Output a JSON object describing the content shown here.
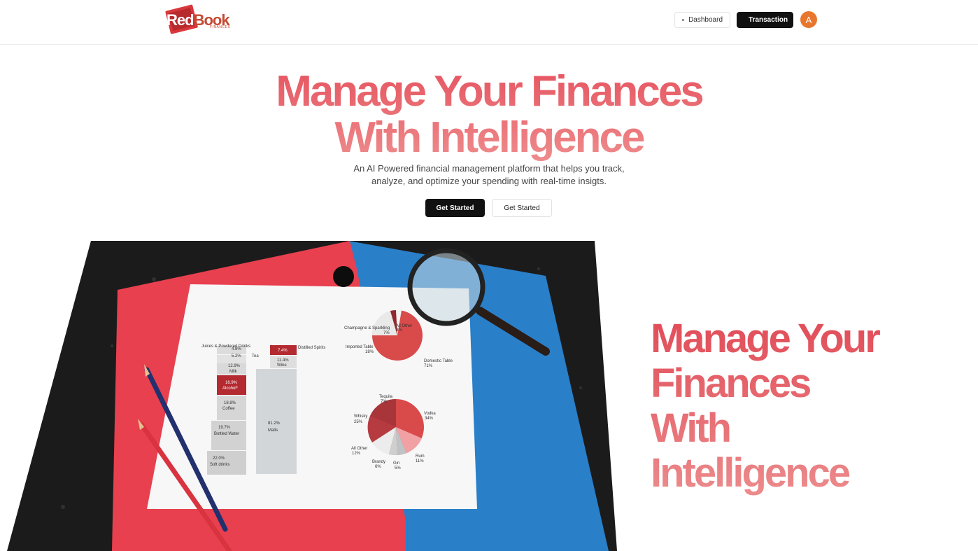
{
  "header": {
    "logo": {
      "word_red": "Red",
      "word_book": "Book",
      "subtitle": "FINANCES"
    },
    "nav": {
      "dashboard_label": "Dashboard",
      "transaction_label": "Transaction"
    },
    "avatar_initial": "A"
  },
  "hero": {
    "title_line1": "Manage Your Finances",
    "title_line2": "With Intelligence",
    "subtitle_line1": "An AI Powered financial management platform that helps you track,",
    "subtitle_line2": "analyze, and optimize your spending with real-time insigts.",
    "primary_cta": "Get Started",
    "secondary_cta": "Get Started"
  },
  "image": {
    "column_labels": [
      {
        "value": "4.8%",
        "name": "Juices & Powdered Drinks"
      },
      {
        "value": "5.2%",
        "name": "Tea"
      },
      {
        "value": "12.9%",
        "name": "Milk"
      },
      {
        "value": "16.9%",
        "name": "Alcohol*"
      },
      {
        "value": "18.8%",
        "name": "Coffee"
      },
      {
        "value": "19.7%",
        "name": "Bottled Water"
      },
      {
        "value": "22.0%",
        "name": "Soft drinks"
      }
    ],
    "column2_labels": [
      {
        "value": "7.4%",
        "name": "Distilled Spirits"
      },
      {
        "value": "11.4%",
        "name": "Wine"
      },
      {
        "value": "81.2%",
        "name": "Malts"
      }
    ],
    "pie1_labels": [
      {
        "name": "Champagne & Sparkling",
        "value": "7%"
      },
      {
        "name": "All Other",
        "value": "3%"
      },
      {
        "name": "Imported Table",
        "value": "18%"
      },
      {
        "name": "Domestic Table",
        "value": "71%"
      }
    ],
    "pie2_labels": [
      {
        "name": "Tequila",
        "value": "7%"
      },
      {
        "name": "Vodka",
        "value": "34%"
      },
      {
        "name": "Whisky",
        "value": "25%"
      },
      {
        "name": "All Other",
        "value": "12%"
      },
      {
        "name": "Rum",
        "value": "11%"
      },
      {
        "name": "Brandy",
        "value": "6%"
      },
      {
        "name": "Gin",
        "value": "5%"
      }
    ]
  },
  "side_title": {
    "line1": "Manage Your",
    "line2": "Finances",
    "line3": "With",
    "line4": "Intelligence"
  },
  "colors": {
    "accent_gradient_start": "#e65561",
    "accent_gradient_end": "#ee8b8c",
    "primary_button": "#111111",
    "avatar": "#e8762d"
  }
}
